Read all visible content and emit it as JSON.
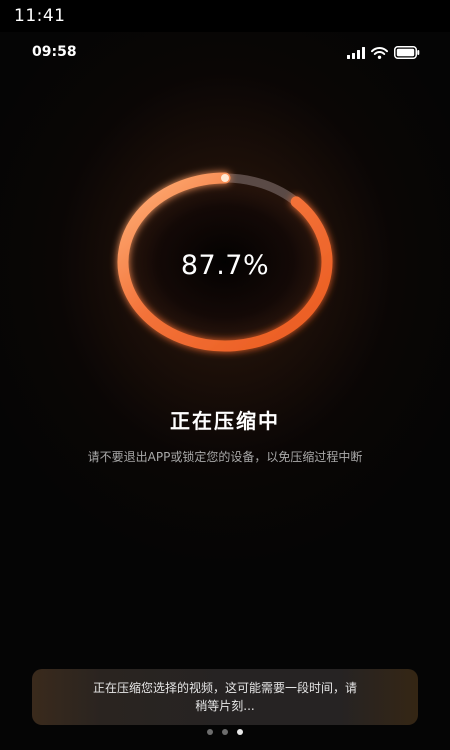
{
  "outer_status": {
    "time": "11:41"
  },
  "status_bar": {
    "time": "09:58",
    "icons": [
      "cellular-signal-icon",
      "wifi-icon",
      "battery-icon"
    ]
  },
  "progress": {
    "value": 0.877,
    "label": "87.7%"
  },
  "colors": {
    "accent_orange": "#f06a2a",
    "accent_light": "#ffb37a",
    "track": "#5a4a46",
    "background": "#050505"
  },
  "main": {
    "title": "正在压缩中",
    "subtitle": "请不要退出APP或锁定您的设备，以免压缩过程中断"
  },
  "toast": {
    "text": "正在压缩您选择的视频，这可能需要一段时间，请稍等片刻..."
  },
  "pager": {
    "count": 3,
    "active_index": 2
  }
}
